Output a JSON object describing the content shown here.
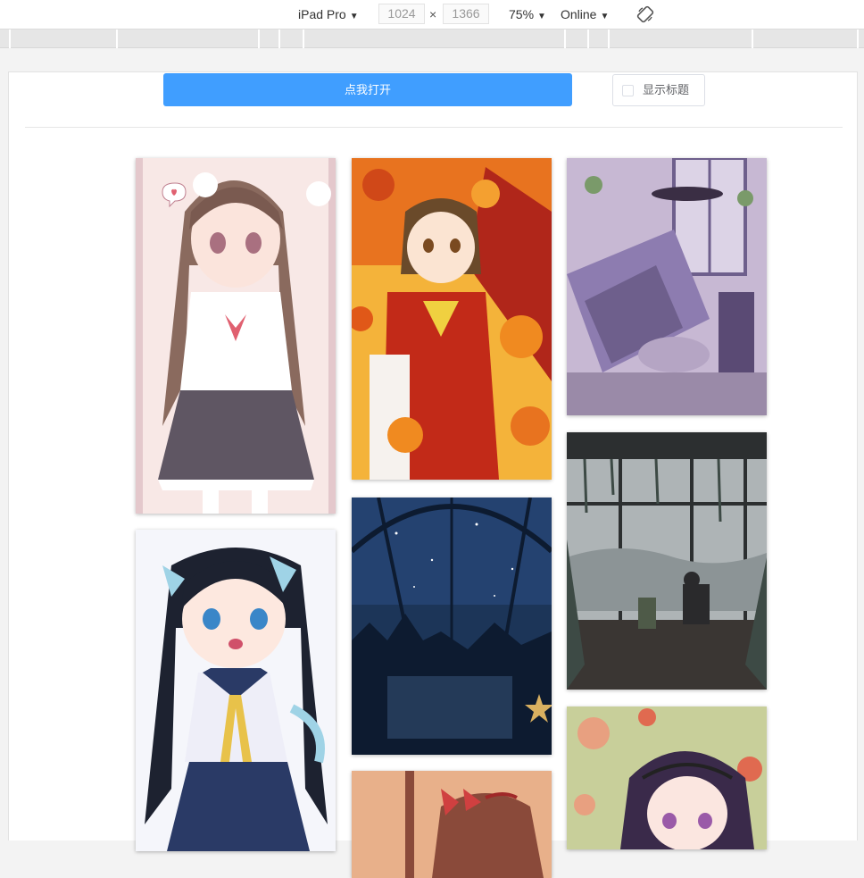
{
  "devtools": {
    "device": "iPad Pro",
    "width": "1024",
    "times": "×",
    "height": "1366",
    "zoom": "75%",
    "network": "Online",
    "arrow": "▼"
  },
  "toolbar": {
    "open_label": "点我打开",
    "show_title_label": "显示标题",
    "show_title_checked": false
  },
  "gallery": {
    "columns": 3,
    "images": [
      {
        "column": 1,
        "subject": "girl with twin tails in school uniform",
        "palette": [
          "#f8e8e6",
          "#8a6a5e",
          "#5f5663"
        ]
      },
      {
        "column": 1,
        "subject": "girl with blue ribbons and sailor outfit",
        "palette": [
          "#f5f6fb",
          "#1d2230",
          "#9fd3e6"
        ]
      },
      {
        "column": 2,
        "subject": "shrine maiden under autumn maple leaves",
        "palette": [
          "#e8731f",
          "#f4b33a",
          "#b0261a"
        ]
      },
      {
        "column": 2,
        "subject": "starry night dome interior",
        "palette": [
          "#1c3558",
          "#0d1b30",
          "#d8b060"
        ]
      },
      {
        "column": 2,
        "subject": "girl with red bow, warm tones",
        "palette": [
          "#e8b08a",
          "#8a4a3a",
          "#d04040"
        ]
      },
      {
        "column": 3,
        "subject": "lavender room with ceiling fan",
        "palette": [
          "#c7b8d3",
          "#6e5f8c",
          "#9a8aa8"
        ]
      },
      {
        "column": 3,
        "subject": "rainy greenhouse window view",
        "palette": [
          "#aeb4b6",
          "#3d4a45",
          "#2c2f30"
        ]
      },
      {
        "column": 3,
        "subject": "girl with dark hair among flowers",
        "palette": [
          "#c8cf9a",
          "#3a2a4a",
          "#e06a50"
        ]
      }
    ]
  }
}
